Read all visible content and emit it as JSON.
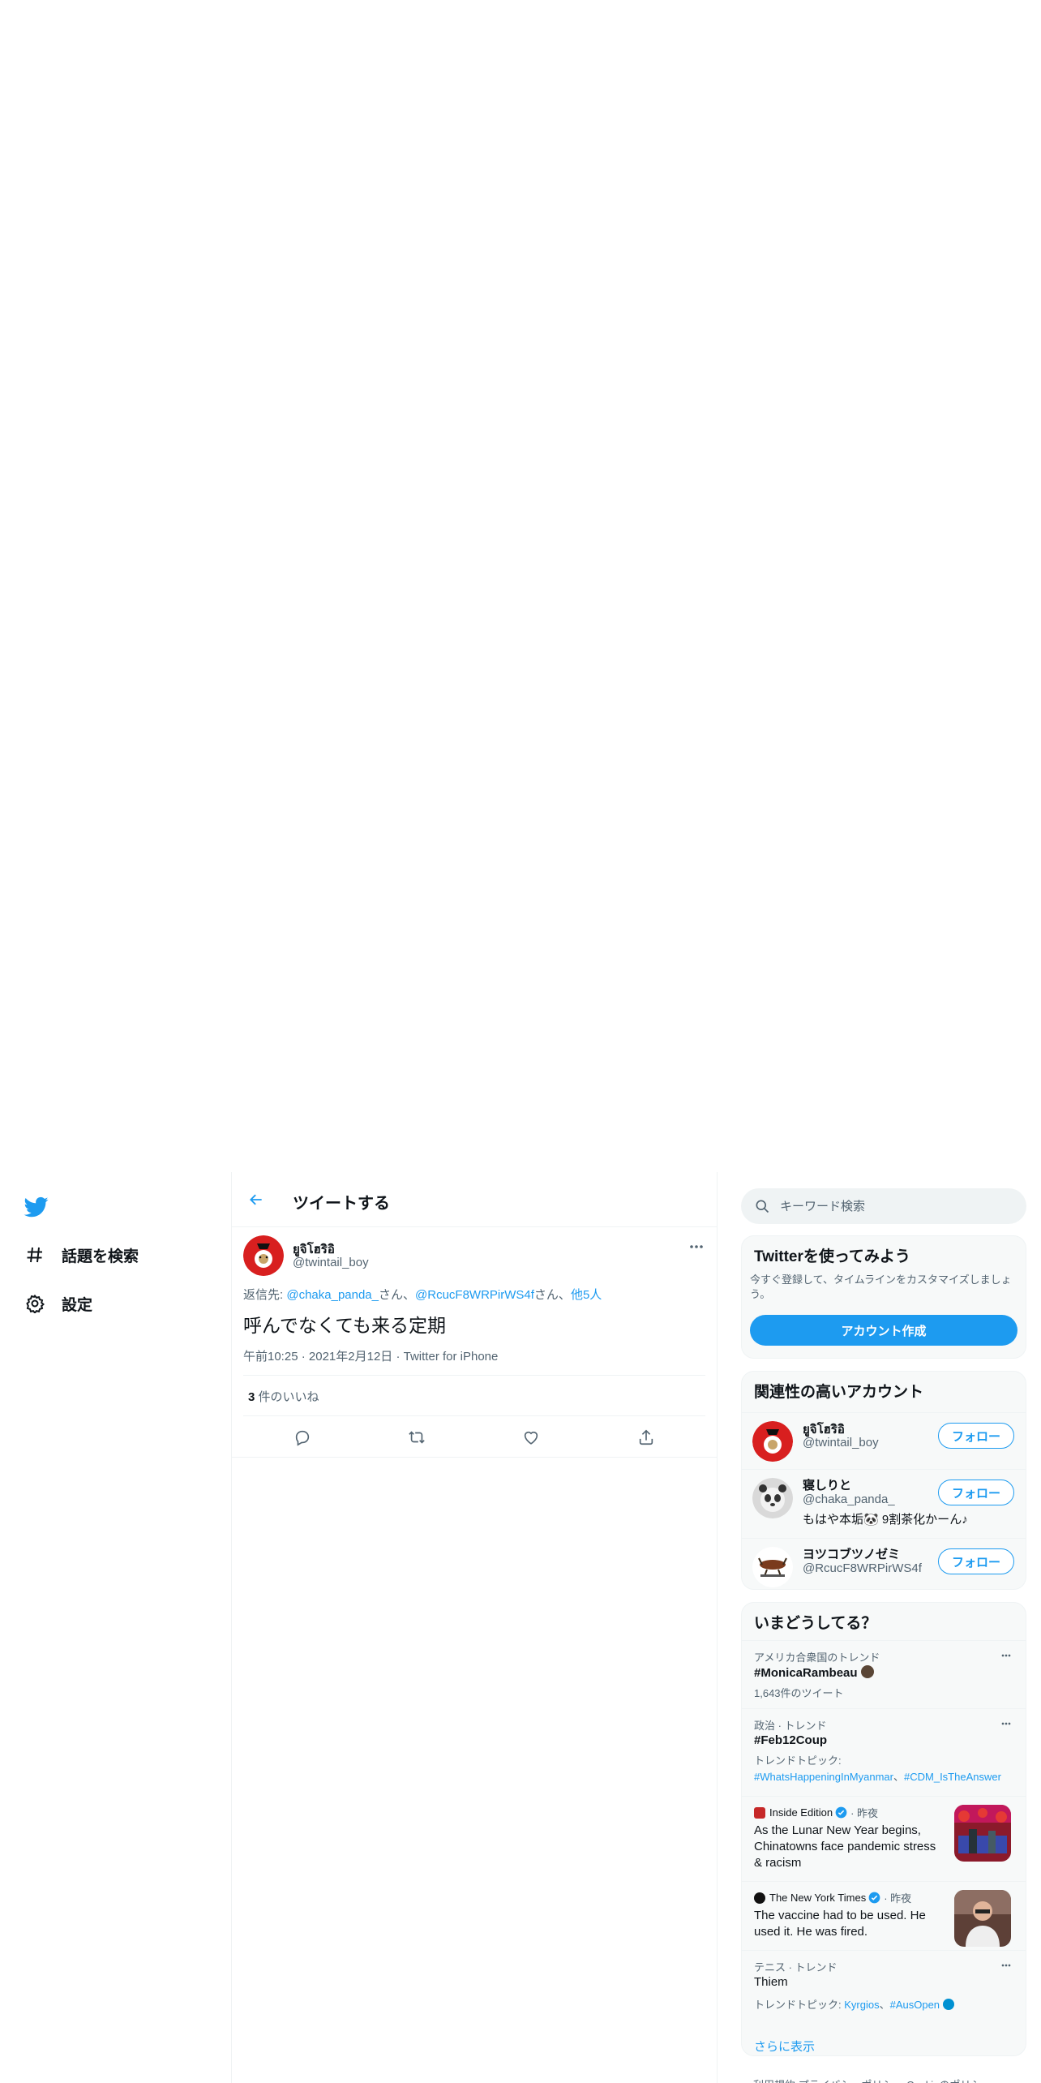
{
  "nav": {
    "items": [
      {
        "label": "話題を検索",
        "icon": "hashtag-icon"
      },
      {
        "label": "設定",
        "icon": "gear-icon"
      }
    ]
  },
  "header": {
    "title": "ツイートする"
  },
  "tweet": {
    "author_name": "ยูจิโฮริอิ",
    "author_handle": "@twintail_boy",
    "reply_prefix": "返信先: ",
    "reply_mention1": "@chaka_panda_",
    "reply_sep1": "さん、",
    "reply_mention2": "@RcucF8WRPirWS4f",
    "reply_sep2": "さん、",
    "reply_others": "他5人",
    "text": "呼んでなくても来る定期",
    "time": "午前10:25",
    "date": "2021年2月12日",
    "source": "Twitter for iPhone",
    "like_count": "3",
    "like_label": " 件のいいね"
  },
  "search": {
    "placeholder": "キーワード検索"
  },
  "signup": {
    "title": "Twitterを使ってみよう",
    "desc": "今すぐ登録して、タイムラインをカスタマイズしましょう。",
    "button": "アカウント作成"
  },
  "related": {
    "title": "関連性の高いアカウント",
    "follow_label": "フォロー",
    "accounts": [
      {
        "name": "ยูจิโฮริอิ",
        "handle": "@twintail_boy",
        "bio": ""
      },
      {
        "name": "寝しりと",
        "handle": "@chaka_panda_",
        "bio": "もはや本垢🐼 9割茶化かーん♪"
      },
      {
        "name": "ヨツコブツノゼミ",
        "handle": "@RcucF8WRPirWS4f",
        "bio": ""
      }
    ]
  },
  "trends": {
    "title": "いまどうしてる？",
    "items": [
      {
        "context": "アメリカ合衆国のトレンド",
        "title": "#MonicaRambeau",
        "sub": "1,643件のツイート"
      },
      {
        "context": "政治 · トレンド",
        "title": "#Feb12Coup",
        "sub_prefix": "トレンドトピック: ",
        "link1": "#WhatsHappeningInMyanmar",
        "sep": "、",
        "link2": "#CDM_IsTheAnswer"
      },
      {
        "source": "Inside Edition",
        "time": "· 昨夜",
        "headline": "As the Lunar New Year begins, Chinatowns face pandemic stress & racism"
      },
      {
        "source": "The New York Times",
        "time": "· 昨夜",
        "headline": "The vaccine had to be used. He used it. He was fired."
      },
      {
        "context": "テニス · トレンド",
        "title": "Thiem",
        "sub_prefix": "トレンドトピック: ",
        "link1": "Kyrgios",
        "sep": "、",
        "link2": "#AusOpen"
      }
    ],
    "show_more": "さらに表示"
  },
  "footer": {
    "links": "利用規約  プライバシーポリシー  Cookieのポリシー"
  },
  "colors": {
    "accent": "#1d9bf0",
    "text": "#0f1419",
    "muted": "#536471",
    "border": "#eff3f4"
  }
}
